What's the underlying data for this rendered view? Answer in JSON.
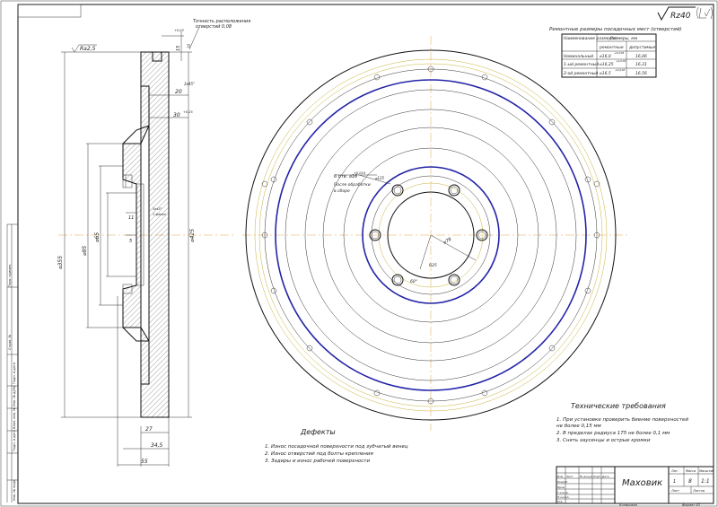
{
  "surface_finish": "Rz40",
  "left_view": {
    "tolerance_note_line1": "Точность расположения",
    "tolerance_note_line2": "отверстий 0,08",
    "top_tol": "+0,03",
    "dim_15": "15",
    "dim_10": "10",
    "surface_finish": "Ra2,5",
    "dim_20": "20",
    "dim_30": "30",
    "tol_30": "+0,25",
    "dim_11": "11",
    "dim_5": "5",
    "dia_inner": "⌀95",
    "dia_bore": "⌀65",
    "dia_outer": "⌀425",
    "dia_left": "⌀355",
    "dim_27": "27",
    "dim_345": "34,5",
    "dim_55": "55",
    "center_note": "3x45°",
    "center_note2": "1 фаска"
  },
  "right_view": {
    "bolt_note_line1": "6 отв. ⌀16",
    "bolt_note_tol": "+0,018",
    "bolt_note_line2": "После обработки",
    "bolt_note_line3": "в сборе",
    "dia_pcd": "⌀78",
    "angle_r": "R25",
    "angle_label": "60°",
    "small_label": "⌀125"
  },
  "repair_table": {
    "caption": "Ремонтные размеры посадочных мест (отверстий)",
    "headers": [
      "Наименование размеров",
      "Размеры, мм",
      "ремонтные",
      "допустимые"
    ],
    "rows": [
      {
        "name": "Номинальный",
        "repair": "⌀16,0",
        "repair_tol": "+0,018",
        "allowed": "16,06"
      },
      {
        "name": "1-ый ремонтный",
        "repair": "⌀16,25",
        "repair_tol": "+0,018",
        "allowed": "16,31"
      },
      {
        "name": "2-ой ремонтный",
        "repair": "⌀16,5",
        "repair_tol": "+0,018",
        "allowed": "16,56"
      }
    ]
  },
  "defects": {
    "title": "Дефекты",
    "items": [
      "1. Износ посадочной поверхности под зубчатый венец",
      "2. Износ отверстий под болты крепления",
      "3. Задиры и износ рабочей поверхности"
    ]
  },
  "requirements": {
    "title": "Технические требования",
    "items": [
      "1. При установке проверить биение поверхностей",
      "не более 0,15 мм",
      "2. В пределах радиуса 175 не более 0,1 мм",
      "3. Снять заусенцы и острые кромки"
    ]
  },
  "title_block": {
    "name": "Маховик",
    "sheet_label": "Лит.",
    "mass_label": "Масса",
    "scale_label": "Масштаб",
    "mass_value": "8",
    "scale_value": "1:1",
    "lit_value": "1",
    "sheet": "Лист",
    "sheets": "Листов",
    "row_labels": [
      "Изм.",
      "Лист",
      "№ докум.",
      "Подп.",
      "Дата"
    ],
    "roles": [
      "Разраб.",
      "Пров.",
      "Т.контр.",
      "",
      "Н.контр.",
      "Утв."
    ],
    "copied": "Копировал",
    "format": "Формат  А3"
  },
  "side_strip": [
    "Перв. примен.",
    "Справ. №",
    "Подп. и дата",
    "Инв. № дубл.",
    "Взам. инв. №",
    "Подп. и дата",
    "Инв. № подл."
  ]
}
